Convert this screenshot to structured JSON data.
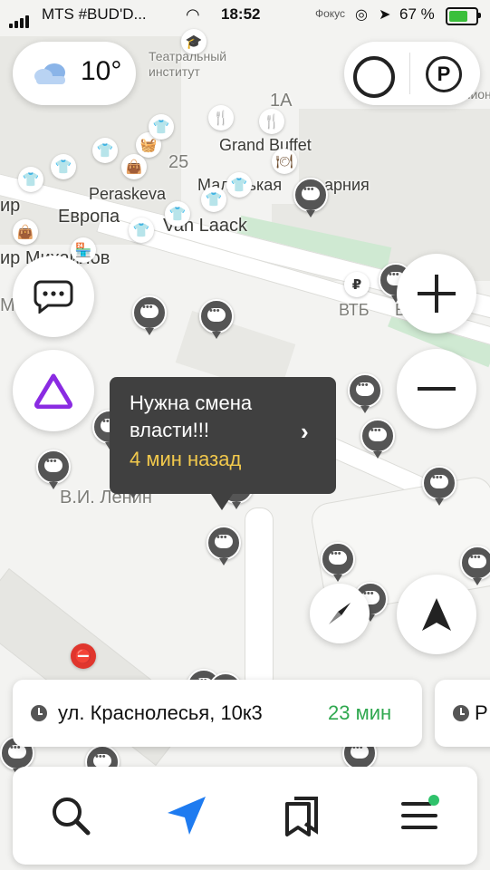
{
  "status_bar": {
    "carrier": "MTS #BUD'D...",
    "time": "18:52",
    "right_label": "Фокус",
    "battery": "67 %"
  },
  "weather": {
    "temperature": "10°",
    "icon": "cloud-icon"
  },
  "map": {
    "labels": [
      "Театральный\nинститут",
      "1А",
      "Grand Buffet",
      "25",
      "Маленькая",
      "арния",
      "Peraskeva",
      "Европа",
      "Van Laack",
      "ир",
      "ир Михайлов",
      "Ма",
      "ВТБ",
      "ВТБ",
      "Вестерн Юнион",
      "В.И. Ленин"
    ]
  },
  "tooltip": {
    "message": "Нужна смена власти!!!",
    "time_ago": "4 мин назад"
  },
  "route": {
    "address": "ул. Краснолесья, 10к3",
    "duration": "23 мин",
    "next_card_letter": "Р"
  },
  "tabbar": {
    "items": [
      {
        "icon": "search-icon"
      },
      {
        "icon": "navigation-arrow-icon",
        "color": "#1e7bf0"
      },
      {
        "icon": "bookmarks-icon"
      },
      {
        "icon": "menu-icon",
        "badge_color": "#2fc26b"
      }
    ]
  },
  "colors": {
    "alice": "#8a2be2",
    "tooltip_time": "#f2c94c",
    "route_time": "#2fa84f"
  }
}
